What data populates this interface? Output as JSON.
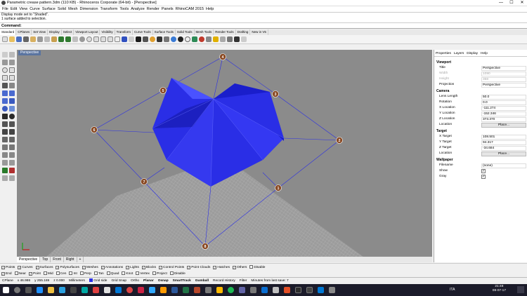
{
  "window": {
    "title": "Parametric crease pattern.3dm (110 KB) - Rhinoceros Corporate (64-bit) - [Perspective]",
    "min": "—",
    "max": "☐",
    "close": "✕"
  },
  "menu": [
    "File",
    "Edit",
    "View",
    "Curve",
    "Surface",
    "Solid",
    "Mesh",
    "Dimension",
    "Transform",
    "Tools",
    "Analyze",
    "Render",
    "Panels",
    "RhinoCAM 2015",
    "Help"
  ],
  "command_history": [
    "Display mode set to \"Shaded\".",
    "1 surface added to selection."
  ],
  "command_prompt": "Command:",
  "toolbar_tabs": [
    "Standard",
    "CPlanes",
    "Set View",
    "Display",
    "Select",
    "Viewport Layout",
    "Visibility",
    "Transform",
    "Curve Tools",
    "Surface Tools",
    "Solid Tools",
    "Mesh Tools",
    "Render Tools",
    "Drafting",
    "New in V5"
  ],
  "viewport": {
    "label": "Perspective",
    "tabs": [
      "Perspective",
      "Top",
      "Front",
      "Right"
    ],
    "add": "+"
  },
  "points": [
    "1",
    "2",
    "3",
    "4",
    "5",
    "6",
    "7",
    "8"
  ],
  "panel": {
    "tabs": [
      "Properties",
      "Layers",
      "Display",
      "Help"
    ],
    "viewport_section": "Viewport",
    "viewport_rows": [
      {
        "k": "Title",
        "v": "Perspective"
      },
      {
        "k": "Width",
        "v": "1090"
      },
      {
        "k": "Height",
        "v": "358"
      },
      {
        "k": "Projection",
        "v": "Perspective"
      }
    ],
    "camera_section": "Camera",
    "camera_rows": [
      {
        "k": "Lens Length",
        "v": "50.0"
      },
      {
        "k": "Rotation",
        "v": "0.0"
      },
      {
        "k": "X Location",
        "v": "-111.274"
      },
      {
        "k": "Y Location",
        "v": "-152.346"
      },
      {
        "k": "Z Location",
        "v": "373.370"
      },
      {
        "k": "Location",
        "v": "Place..."
      }
    ],
    "target_section": "Target",
    "target_rows": [
      {
        "k": "X Target",
        "v": "108.501"
      },
      {
        "k": "Y Target",
        "v": "94.317"
      },
      {
        "k": "Z Target",
        "v": "-34.684"
      },
      {
        "k": "Location",
        "v": "Place..."
      }
    ],
    "wallpaper_section": "Wallpaper",
    "wallpaper_rows": [
      {
        "k": "Filename",
        "v": "(none)"
      },
      {
        "k": "Show",
        "v": "✓"
      },
      {
        "k": "Gray",
        "v": "✓"
      }
    ]
  },
  "osnap_row1": [
    "Points",
    "Curves",
    "Surfaces",
    "Polysurfaces",
    "Meshes",
    "Annotations",
    "Lights",
    "Blocks",
    "Control Points",
    "Point Clouds",
    "Hatches",
    "Others",
    "Disable"
  ],
  "osnap_row2": [
    "End",
    "Near",
    "Point",
    "Mid",
    "Cen",
    "Int",
    "Perp",
    "Tan",
    "Quad",
    "Knot",
    "Vertex",
    "Project",
    "Disable"
  ],
  "status": {
    "cplane": "CPlane",
    "x": "x 46.986",
    "y": "y 255.169",
    "z": "z 0.000",
    "units": "Millimeters",
    "layer": "Grid side",
    "items": [
      "Grid Snap",
      "Ortho",
      "Planar",
      "Osnap",
      "SmartTrack",
      "Gumball",
      "Record History",
      "Filter"
    ],
    "message": "Minutes from last save: 7"
  },
  "taskbar": {
    "time": "21:48",
    "date": "08-07-17",
    "lang": "ITA"
  },
  "colors": {
    "model": "#2a2ee6",
    "grid": "#a9a9a9",
    "viewport_bg": "#8b8b8b",
    "point": "#8a4a24"
  }
}
